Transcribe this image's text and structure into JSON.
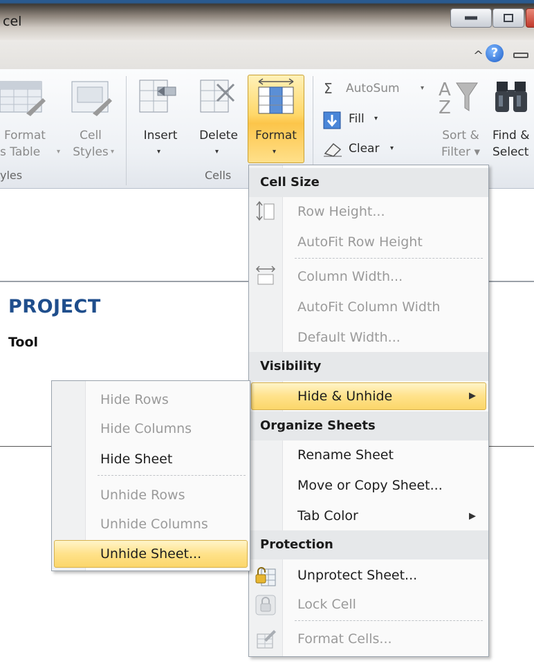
{
  "window": {
    "title": "cel"
  },
  "header": {
    "help_symbol": "?",
    "collapse_symbol": "^"
  },
  "ribbon": {
    "styles_group": {
      "format_table_line1": "Format",
      "format_table_line2": "s Table",
      "cell_styles_line1": "Cell",
      "cell_styles_line2": "Styles",
      "group_label": "yles"
    },
    "cells_group": {
      "insert_label": "Insert",
      "delete_label": "Delete",
      "format_label": "Format",
      "group_label": "Cells"
    },
    "editing_group": {
      "autosum_label": "AutoSum",
      "fill_label": "Fill",
      "clear_label": "Clear",
      "sort_line1": "Sort &",
      "sort_line2": "Filter",
      "find_line1": "Find &",
      "find_line2": "Select"
    }
  },
  "sheet": {
    "title": "PROJECT",
    "subtitle": "Tool"
  },
  "format_menu": {
    "cell_size_header": "Cell Size",
    "row_height": "Row Height...",
    "autofit_row_height": "AutoFit Row Height",
    "column_width": "Column Width...",
    "autofit_column_width": "AutoFit Column Width",
    "default_width": "Default Width...",
    "visibility_header": "Visibility",
    "hide_unhide": "Hide & Unhide",
    "organize_header": "Organize Sheets",
    "rename_sheet": "Rename Sheet",
    "move_copy_sheet": "Move or Copy Sheet...",
    "tab_color": "Tab Color",
    "protection_header": "Protection",
    "unprotect_sheet": "Unprotect Sheet...",
    "lock_cell": "Lock Cell",
    "format_cells": "Format Cells..."
  },
  "hide_unhide_menu": {
    "hide_rows": "Hide Rows",
    "hide_columns": "Hide Columns",
    "hide_sheet": "Hide Sheet",
    "unhide_rows": "Unhide Rows",
    "unhide_columns": "Unhide Columns",
    "unhide_sheet": "Unhide Sheet..."
  },
  "colors": {
    "highlight": "#ffe28a",
    "highlight_border": "#d7b14c",
    "title_blue": "#1f4e8c",
    "disabled_text": "#9a9a9a"
  }
}
